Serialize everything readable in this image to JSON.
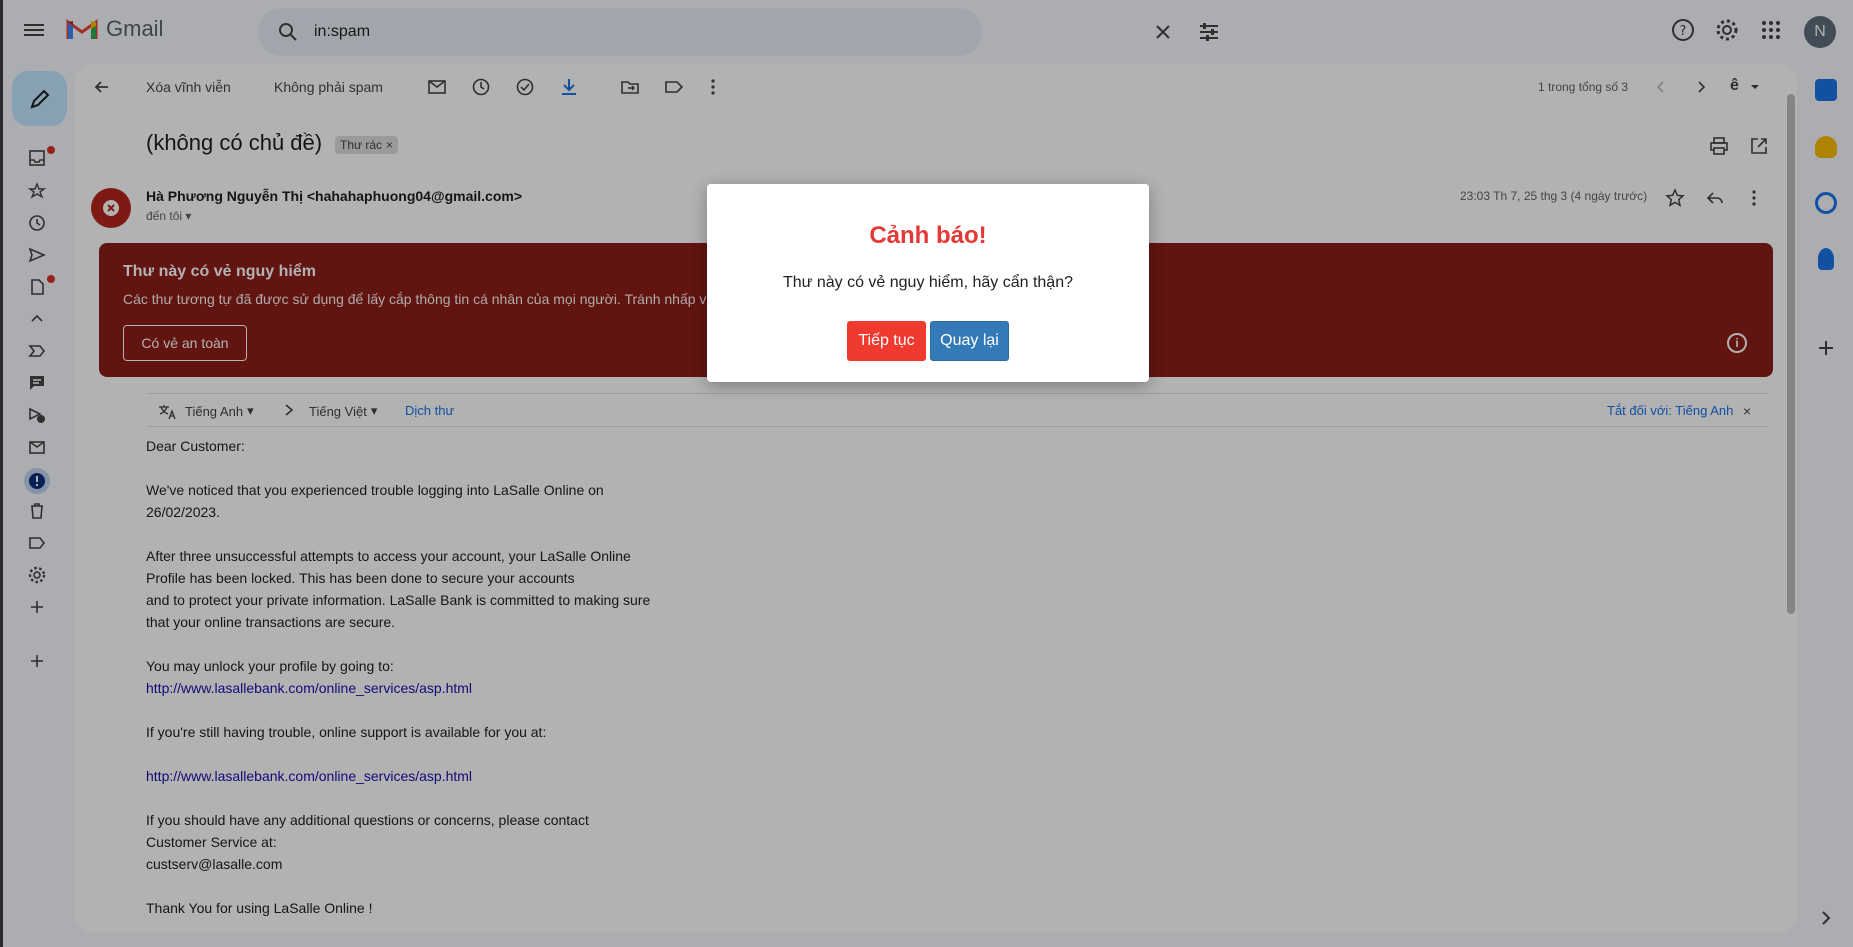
{
  "app": {
    "name": "Gmail",
    "avatar_initial": "N"
  },
  "search": {
    "query": "in:spam"
  },
  "toolbar": {
    "delete_forever": "Xóa vĩnh viễn",
    "not_spam": "Không phải spam",
    "pager": "1 trong tổng số 3",
    "lang_glyph": "ê"
  },
  "email": {
    "subject": "(không có chủ đề)",
    "label": "Thư rác",
    "sender": "Hà Phương Nguyễn Thị <hahahaphuong04@gmail.com>",
    "to": "đến tôi",
    "date": "23:03 Th 7, 25 thg 3 (4 ngày trước)"
  },
  "warning_banner": {
    "title": "Thư này có vẻ nguy hiểm",
    "text": "Các thư tương tự đã được sử dụng để lấy cắp thông tin cá nhân của mọi người. Tránh nhấp v",
    "safe_button": "Có vẻ an toàn",
    "info_icon": "i"
  },
  "translate": {
    "from": "Tiếng Anh",
    "to": "Tiếng Việt",
    "action": "Dịch thư",
    "turn_off": "Tắt đối với: Tiếng Anh"
  },
  "body": {
    "greeting": "Dear Customer:",
    "p1": "We've noticed that you experienced trouble logging into LaSalle Online on 26/02/2023.",
    "p2a": "After three unsuccessful attempts to access your account, your LaSalle Online Profile has been locked. This has been done to secure your accounts",
    "p2b": "and to protect your private information. LaSalle Bank is committed to making sure that your online transactions are secure.",
    "p3": "You may unlock your profile by going to:",
    "link1": "http://www.lasallebank.com/online_services/asp.html",
    "p4": "If you're still having trouble, online support is available for you at:",
    "link2": "http://www.lasallebank.com/online_services/asp.html",
    "p5a": "If you should have any additional questions or concerns, please contact",
    "p5b": "Customer Service at:",
    "p5c": "custserv@lasalle.com",
    "p6": "Thank You for using LaSalle Online !"
  },
  "modal": {
    "title": "Cảnh báo!",
    "message": "Thư này có vẻ nguy hiểm, hãy cẩn thận?",
    "continue": "Tiếp tục",
    "back": "Quay lại"
  },
  "colors": {
    "danger_banner": "#8c1d18",
    "modal_title": "#e53935",
    "continue_btn": "#f03a2f",
    "back_btn": "#337ab7"
  }
}
